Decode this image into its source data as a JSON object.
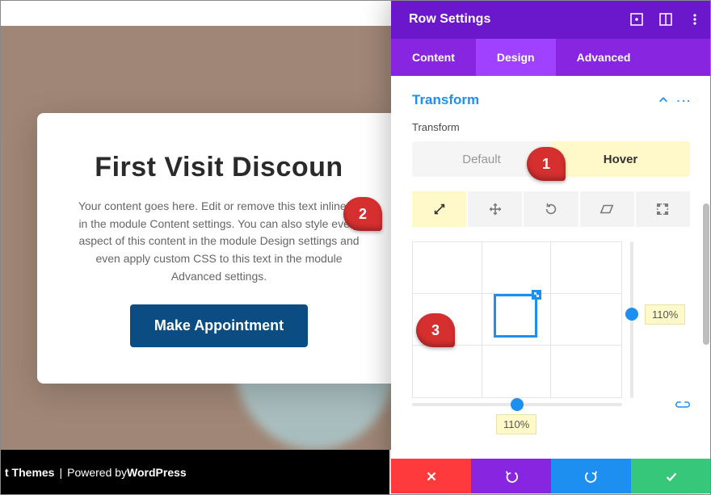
{
  "preview": {
    "headline": "First Visit Discoun",
    "paragraph": "Your content goes here. Edit or remove this text inline or in the module Content settings. You can also style every aspect of this content in the module Design settings and even apply custom CSS to this text in the module Advanced settings.",
    "button_label": "Make Appointment",
    "footer_themes": "t Themes",
    "footer_sep": " | ",
    "footer_pow": "Powered by ",
    "footer_wp": "WordPress"
  },
  "panel": {
    "title": "Row Settings",
    "tabs": {
      "content": "Content",
      "design": "Design",
      "advanced": "Advanced",
      "active": "design"
    },
    "section": {
      "title": "Transform",
      "label": "Transform"
    },
    "state": {
      "default": "Default",
      "hover": "Hover"
    },
    "transform_tabs": {
      "scale": "scale",
      "translate": "translate",
      "rotate": "rotate",
      "skew": "skew",
      "origin": "origin"
    },
    "values": {
      "x": "110%",
      "y": "110%"
    }
  },
  "callouts": {
    "one": "1",
    "two": "2",
    "three": "3"
  }
}
